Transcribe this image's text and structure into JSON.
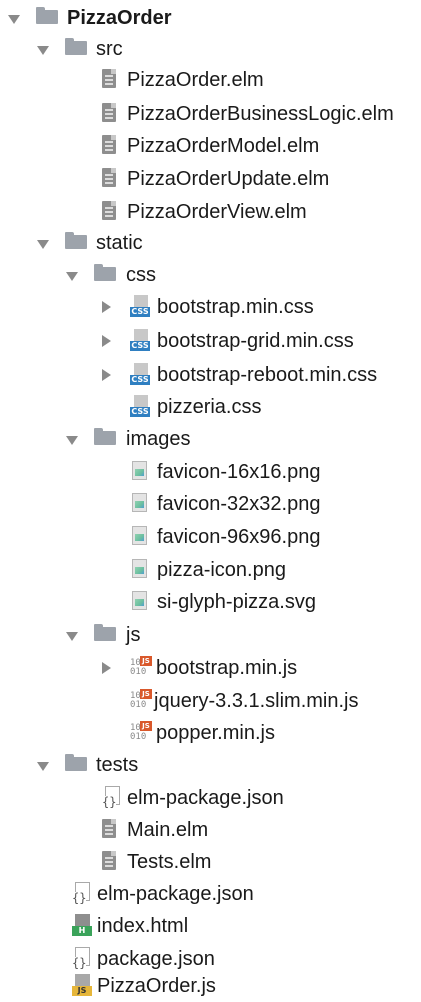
{
  "tree": {
    "root": {
      "label": "PizzaOrder"
    },
    "src": {
      "label": "src",
      "files": [
        "PizzaOrder.elm",
        "PizzaOrderBusinessLogic.elm",
        "PizzaOrderModel.elm",
        "PizzaOrderUpdate.elm",
        "PizzaOrderView.elm"
      ]
    },
    "static": {
      "label": "static",
      "css": {
        "label": "css",
        "files": [
          "bootstrap.min.css",
          "bootstrap-grid.min.css",
          "bootstrap-reboot.min.css",
          "pizzeria.css"
        ]
      },
      "images": {
        "label": "images",
        "files": [
          "favicon-16x16.png",
          "favicon-32x32.png",
          "favicon-96x96.png",
          "pizza-icon.png",
          "si-glyph-pizza.svg"
        ]
      },
      "js": {
        "label": "js",
        "files": [
          "bootstrap.min.js",
          "jquery-3.3.1.slim.min.js",
          "popper.min.js"
        ]
      }
    },
    "tests": {
      "label": "tests",
      "files": [
        "elm-package.json",
        "Main.elm",
        "Tests.elm"
      ]
    },
    "root_files": [
      "elm-package.json",
      "index.html",
      "package.json",
      "PizzaOrder.js"
    ]
  },
  "icon_badges": {
    "css": "CSS",
    "js": "JS",
    "html": "H",
    "json_brace": "{}",
    "bits": "10\n010"
  },
  "colors": {
    "folder": "#9da3ab",
    "arrow": "#8a8a8a",
    "css_badge": "#2f7fc1",
    "js_badge": "#d9582b",
    "html_badge": "#3aa35a",
    "js_root_badge": "#e6b63a"
  },
  "icons": {
    "folder": "folder-icon",
    "expanded": "chevron-down-icon",
    "collapsed": "chevron-right-icon",
    "elm_file": "elm-file-icon",
    "css_file": "css-file-icon",
    "image_file": "image-file-icon",
    "js_file": "js-file-icon",
    "json_file": "json-file-icon",
    "html_file": "html-file-icon"
  }
}
